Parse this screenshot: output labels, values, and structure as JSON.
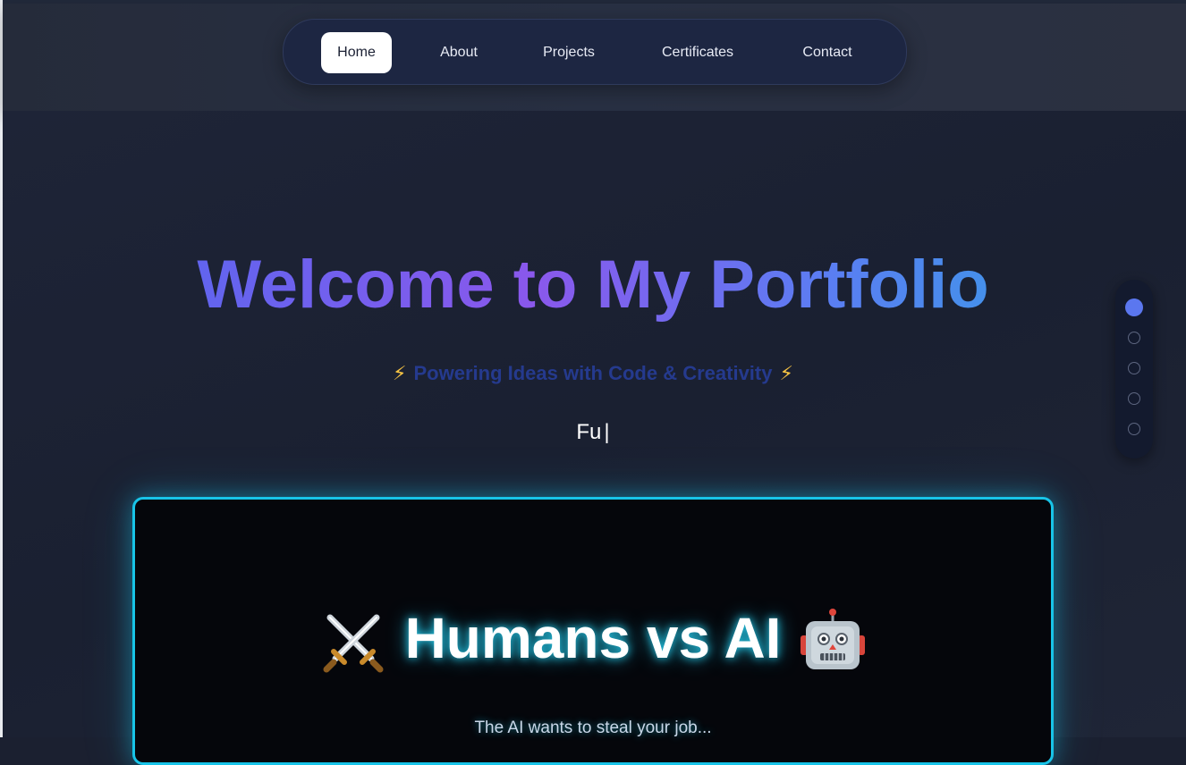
{
  "nav": {
    "items": [
      {
        "label": "Home",
        "active": true
      },
      {
        "label": "About",
        "active": false
      },
      {
        "label": "Projects",
        "active": false
      },
      {
        "label": "Certificates",
        "active": false
      },
      {
        "label": "Contact",
        "active": false
      }
    ]
  },
  "hero": {
    "title": "Welcome to My Portfolio",
    "subtitle": "Powering Ideas with Code & Creativity",
    "subtitle_icon": "lightning-bolt",
    "typed_text": "Fu",
    "cursor": "|"
  },
  "section_dots": {
    "count": 5,
    "active_index": 0
  },
  "game_card": {
    "title": "Humans vs AI",
    "left_icon": "crossed-swords",
    "right_icon": "robot-face",
    "subtitle": "The AI wants to steal your job..."
  },
  "colors": {
    "accent": "#5b77ef",
    "card_border": "#18c4e8",
    "bolt": "#f6c343"
  }
}
